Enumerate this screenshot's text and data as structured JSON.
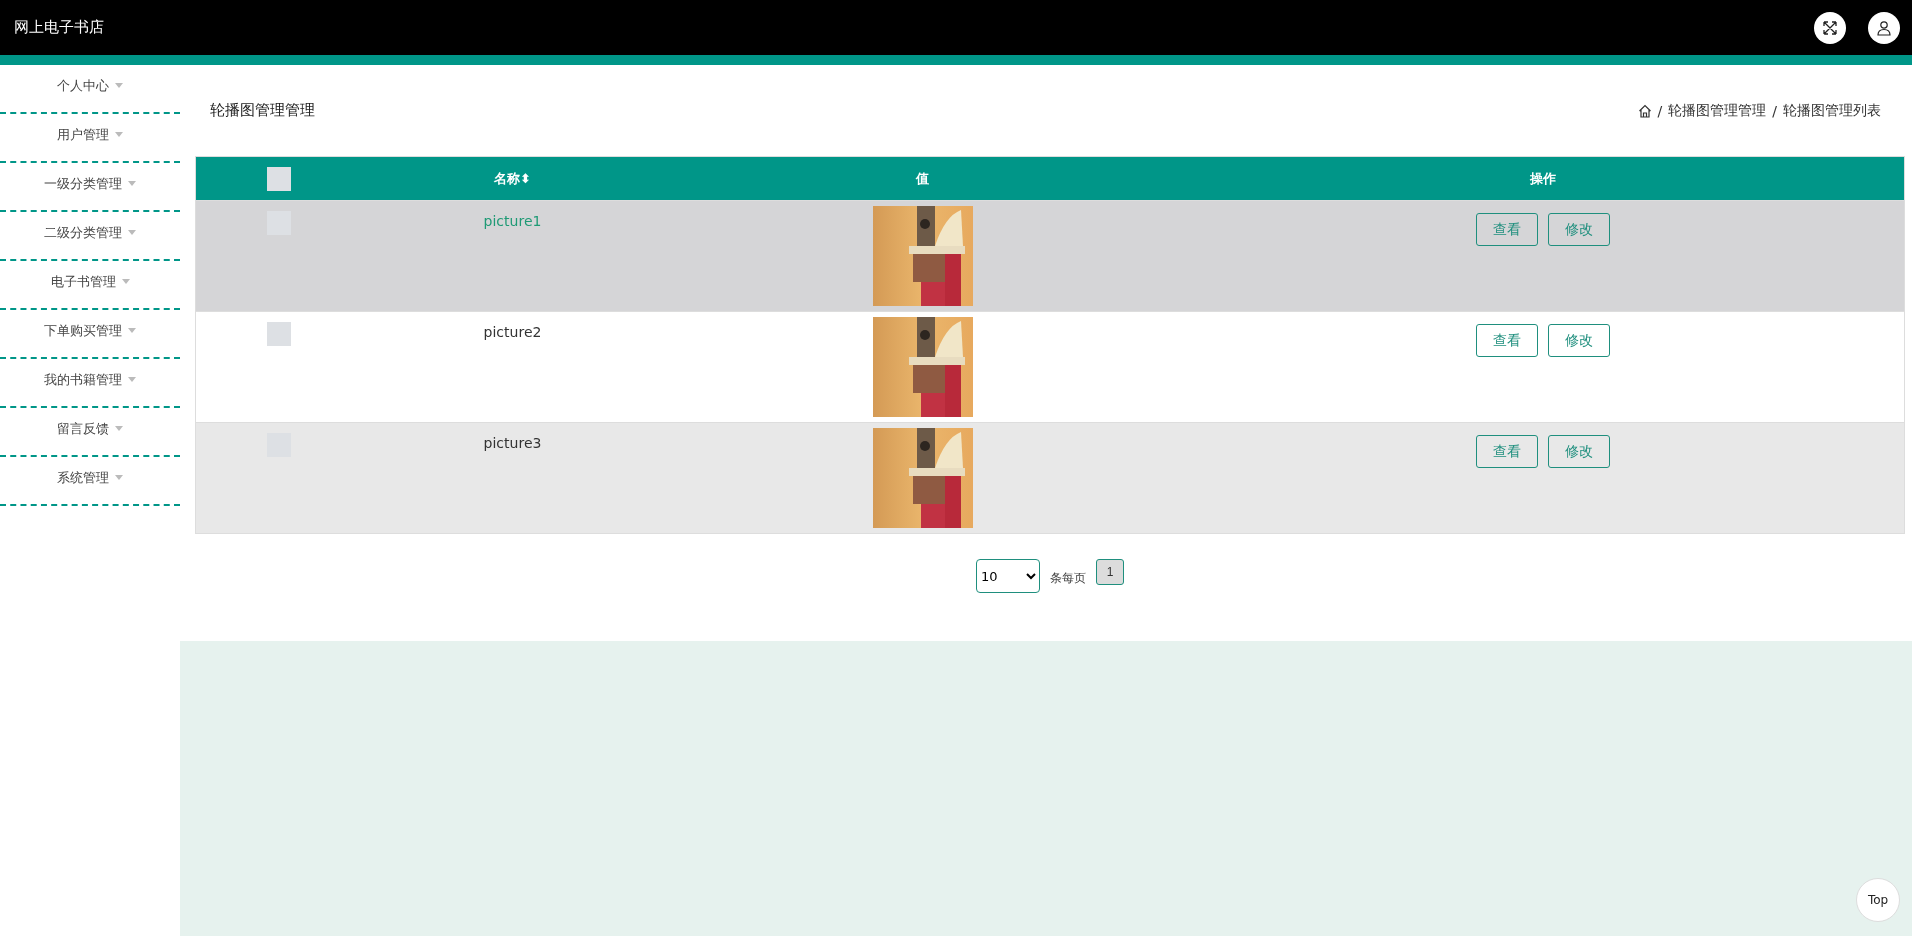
{
  "header": {
    "title": "网上电子书店"
  },
  "sidebar": {
    "items": [
      {
        "label": "个人中心"
      },
      {
        "label": "用户管理"
      },
      {
        "label": "一级分类管理"
      },
      {
        "label": "二级分类管理"
      },
      {
        "label": "电子书管理"
      },
      {
        "label": "下单购买管理"
      },
      {
        "label": "我的书籍管理"
      },
      {
        "label": "留言反馈"
      },
      {
        "label": "系统管理"
      }
    ]
  },
  "page_title": "轮播图管理管理",
  "breadcrumb": {
    "separator": "/",
    "items": [
      "轮播图管理管理",
      "轮播图管理列表"
    ]
  },
  "table": {
    "columns": [
      {
        "label": "名称",
        "sort_icon": "⬍"
      },
      {
        "label": "值"
      },
      {
        "label": "操作"
      }
    ],
    "header_checked": false,
    "rows": [
      {
        "checked": false,
        "hovered": true,
        "name": "picture1",
        "value": {
          "kind": "picture"
        },
        "actions": [
          "查看",
          "修改"
        ]
      },
      {
        "checked": false,
        "hovered": false,
        "name": "picture2",
        "value": {
          "kind": "picture"
        },
        "actions": [
          "查看",
          "修改"
        ]
      },
      {
        "checked": false,
        "hovered": false,
        "name": "picture3",
        "value": {
          "kind": "picture"
        },
        "actions": [
          "查看",
          "修改"
        ]
      }
    ]
  },
  "pagination": {
    "page_size": "10",
    "per_page_label": "条每页",
    "pages": [
      {
        "label": "1",
        "selected": true
      }
    ]
  },
  "back_to_top": "Top"
}
